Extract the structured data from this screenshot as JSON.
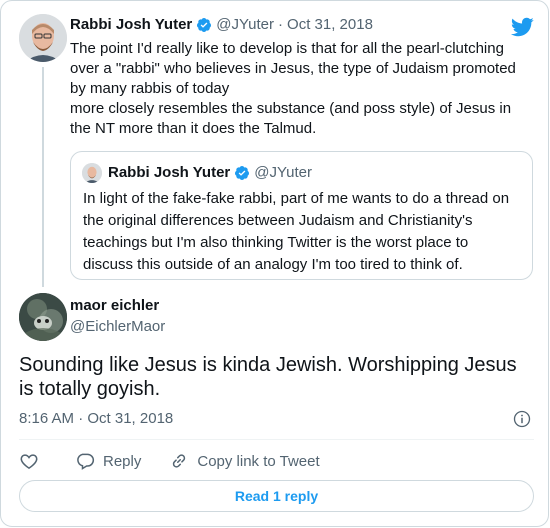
{
  "parent_tweet": {
    "author_name": "Rabbi Josh Yuter",
    "handle": "@JYuter",
    "separator": "·",
    "date": "Oct 31, 2018",
    "text_lines": [
      "The point I'd really like to develop is that for all the pearl-clutching",
      "over a \"rabbi\" who believes in Jesus, the type of Judaism promoted",
      "by many rabbis of today",
      "more closely resembles the substance (and poss style) of Jesus in",
      "the NT more than it does the Talmud."
    ],
    "quoted_tweet": {
      "author_name": "Rabbi Josh Yuter",
      "handle": "@JYuter",
      "text_lines": [
        "In light of the fake-fake rabbi, part of me wants to do a thread on",
        "the original differences between Judaism and Christianity's",
        "teachings but I'm also thinking Twitter is the worst place to",
        "discuss this outside of an analogy I'm too tired to think of."
      ]
    }
  },
  "main_tweet": {
    "author_name": "maor eichler",
    "handle": "@EichlerMaor",
    "text_lines": [
      "Sounding like Jesus is kinda Jewish. Worshipping Jesus",
      "is totally goyish."
    ],
    "timestamp": "8:16 AM · Oct 31, 2018"
  },
  "actions": {
    "like_icon": "heart-icon",
    "reply_label": "Reply",
    "copy_link_label": "Copy link to Tweet"
  },
  "read_reply_label": "Read 1 reply",
  "colors": {
    "accent": "#1d9bf0",
    "text": "#0f1419",
    "secondary": "#536471",
    "border": "#cfd9de",
    "verified": "#1d9bf0"
  }
}
